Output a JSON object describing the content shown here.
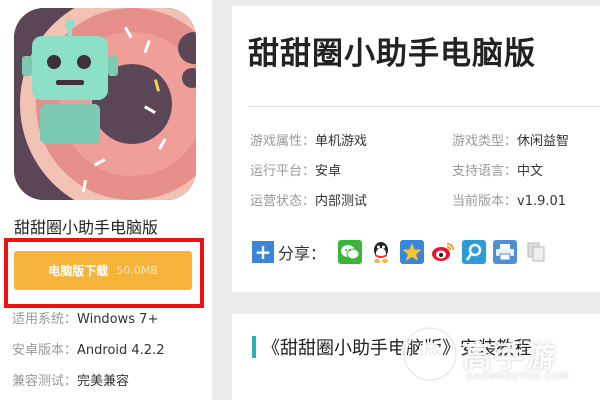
{
  "app": {
    "name": "甜甜圈小助手电脑版",
    "title": "甜甜圈小助手电脑版",
    "download_label": "电脑版下载",
    "download_size": "50.0MB",
    "download_color": "#f7b43a"
  },
  "specs": [
    {
      "label": "适用系统：",
      "value": "Windows 7+"
    },
    {
      "label": "安卓版本：",
      "value": "Android 4.2.2"
    },
    {
      "label": "兼容测试：",
      "value": "完美兼容"
    }
  ],
  "attributes": [
    {
      "label": "游戏属性：",
      "value": "单机游戏"
    },
    {
      "label": "游戏类型：",
      "value": "休闲益智"
    },
    {
      "label": "运行平台：",
      "value": "安卓"
    },
    {
      "label": "支持语言：",
      "value": "中文"
    },
    {
      "label": "运营状态：",
      "value": "内部测试"
    },
    {
      "label": "当前版本：",
      "value": "v1.9.01"
    }
  ],
  "share": {
    "label": "分享：",
    "icons": [
      "plus-icon",
      "wechat-icon",
      "qq-icon",
      "qzone-icon",
      "weibo-icon",
      "tencent-weibo-icon",
      "print-icon",
      "copy-icon"
    ]
  },
  "tutorial_title": "《甜甜圈小助手电脑版》安装教程",
  "watermark": {
    "text": "高手游",
    "sub": "GAOSHOUYOU.COM"
  },
  "colors": {
    "accent": "#2ab0b6",
    "highlight_box": "#ee1111"
  }
}
